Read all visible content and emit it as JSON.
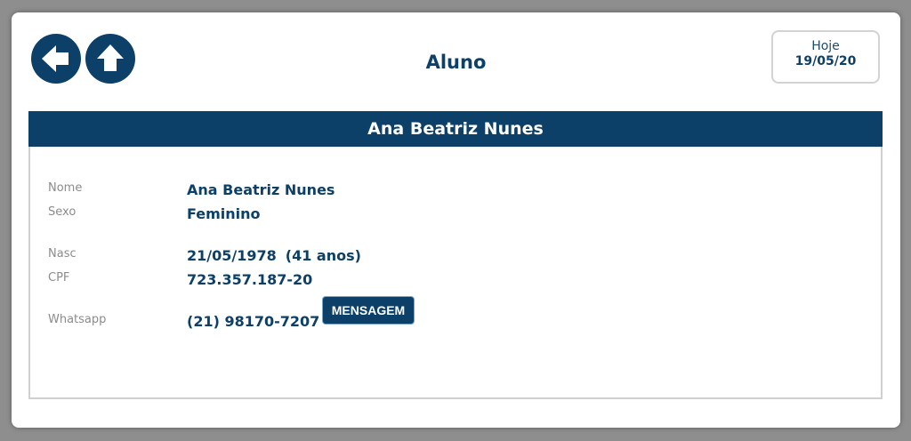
{
  "header": {
    "title": "Aluno",
    "today_label": "Hoje",
    "today_value": "19/05/20"
  },
  "nav": {
    "back_icon": "arrow-left-icon",
    "up_icon": "arrow-up-icon"
  },
  "student": {
    "header_name": "Ana Beatriz Nunes",
    "fields": {
      "nome_label": "Nome",
      "nome": "Ana Beatriz Nunes",
      "sexo_label": "Sexo",
      "sexo": "Feminino",
      "nasc_label": "Nasc",
      "nasc": "21/05/1978",
      "idade": "(41 anos)",
      "cpf_label": "CPF",
      "cpf": "723.357.187-20",
      "whatsapp_label": "Whatsapp",
      "whatsapp": "(21) 98170-7207"
    },
    "message_button": "MENSAGEM"
  },
  "colors": {
    "primary": "#0d4069",
    "label": "#8c8c8c",
    "border": "#d0d0d0"
  }
}
